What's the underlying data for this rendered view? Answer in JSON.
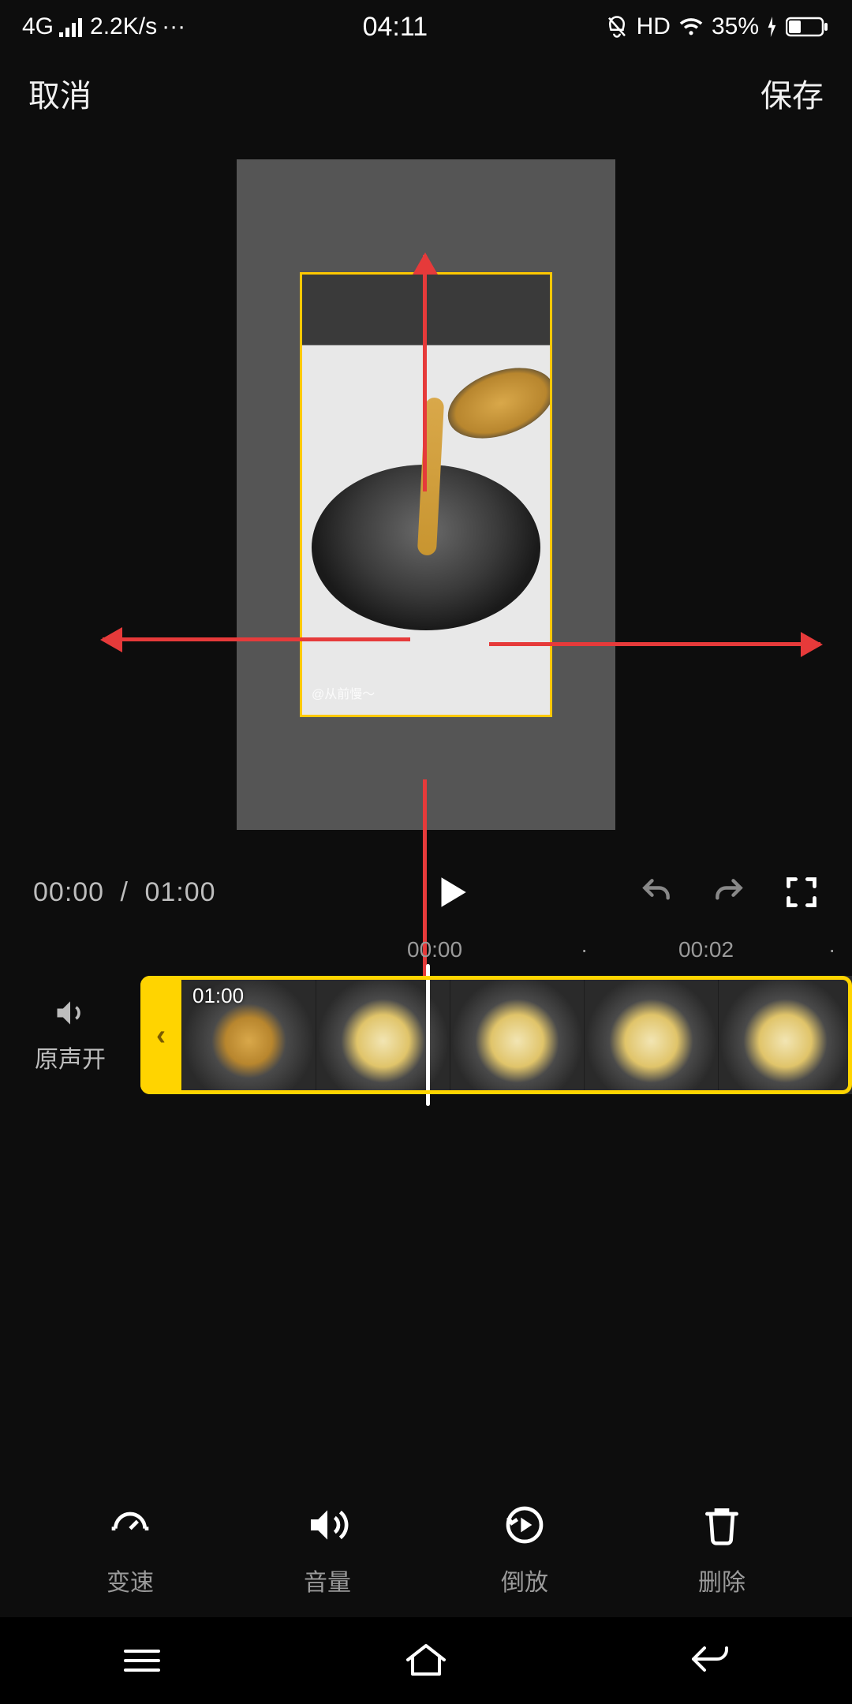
{
  "status_bar": {
    "network": "4G",
    "speed": "2.2K/s",
    "more": "···",
    "time": "04:11",
    "hd": "HD",
    "battery_pct": "35%"
  },
  "top_bar": {
    "cancel": "取消",
    "save": "保存"
  },
  "video_watermark": "@从前慢～",
  "playback": {
    "current": "00:00",
    "sep": "/",
    "total": "01:00"
  },
  "timeline": {
    "tick0": "00:00",
    "dot0": "·",
    "tick1": "00:02",
    "dot1": "·",
    "clip_duration": "01:00"
  },
  "audio": {
    "label": "原声开"
  },
  "toolbar": {
    "speed": "变速",
    "volume": "音量",
    "reverse": "倒放",
    "delete": "删除"
  }
}
